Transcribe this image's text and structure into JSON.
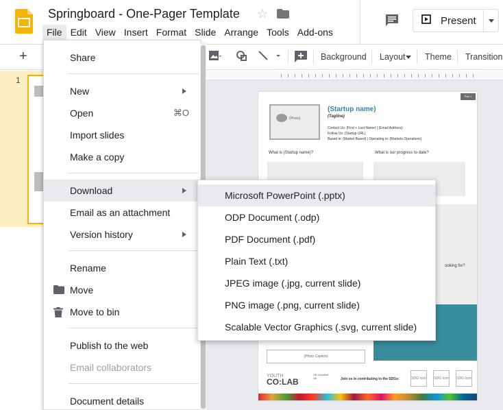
{
  "app": {
    "doc_title": "Springboard - One-Pager Template",
    "menubar": [
      "File",
      "Edit",
      "View",
      "Insert",
      "Format",
      "Slide",
      "Arrange",
      "Tools",
      "Add-ons"
    ],
    "present_label": "Present"
  },
  "toolbar": {
    "background": "Background",
    "layout": "Layout",
    "theme": "Theme",
    "transition": "Transition"
  },
  "filmstrip": {
    "slide_number": "1"
  },
  "file_menu": {
    "items": [
      {
        "label": "Share"
      },
      {
        "label": "New",
        "submenu": true
      },
      {
        "label": "Open",
        "shortcut": "⌘O"
      },
      {
        "label": "Import slides"
      },
      {
        "label": "Make a copy"
      },
      {
        "label": "Download",
        "submenu": true,
        "highlighted": true
      },
      {
        "label": "Email as an attachment"
      },
      {
        "label": "Version history",
        "submenu": true
      },
      {
        "label": "Rename"
      },
      {
        "label": "Move",
        "icon": "folder-icon"
      },
      {
        "label": "Move to bin",
        "icon": "trash-icon"
      },
      {
        "label": "Publish to the web"
      },
      {
        "label": "Email collaborators",
        "disabled": true
      },
      {
        "label": "Document details"
      }
    ]
  },
  "download_submenu": {
    "items": [
      "Microsoft PowerPoint (.pptx)",
      "ODP Document (.odp)",
      "PDF Document (.pdf)",
      "Plain Text (.txt)",
      "JPEG image (.jpg, current slide)",
      "PNG image (.png, current slide)",
      "Scalable Vector Graphics (.svg, current slide)"
    ]
  },
  "slide": {
    "tag": "Part 1",
    "photo": "(Photo)",
    "startup_name": "(Startup name)",
    "tagline": "(Tagline)",
    "contact": "Contact Us: (First + Last Name) | (Email Address)",
    "follow": "Follow Us: (Startup URL)",
    "based": "Based in: (Market Based) | Operating in: (Markets Operations)",
    "q1": "What is (Startup name)?",
    "q2": "What is our progress to date?",
    "q3": "ooking for?",
    "photo_caption": "(Photo Caption)",
    "youth": "YOUTH",
    "colab": "CO:LAB",
    "undp": "UN Vocation citi",
    "join": "Join us in contributing to the SDGs:",
    "sdg": "SDG Icon"
  },
  "colors": {
    "accent_yellow": "#f4b400",
    "filmstrip_bg": "#feefc3",
    "slide_teal": "#368d9c",
    "highlight": "#e8eaed"
  }
}
